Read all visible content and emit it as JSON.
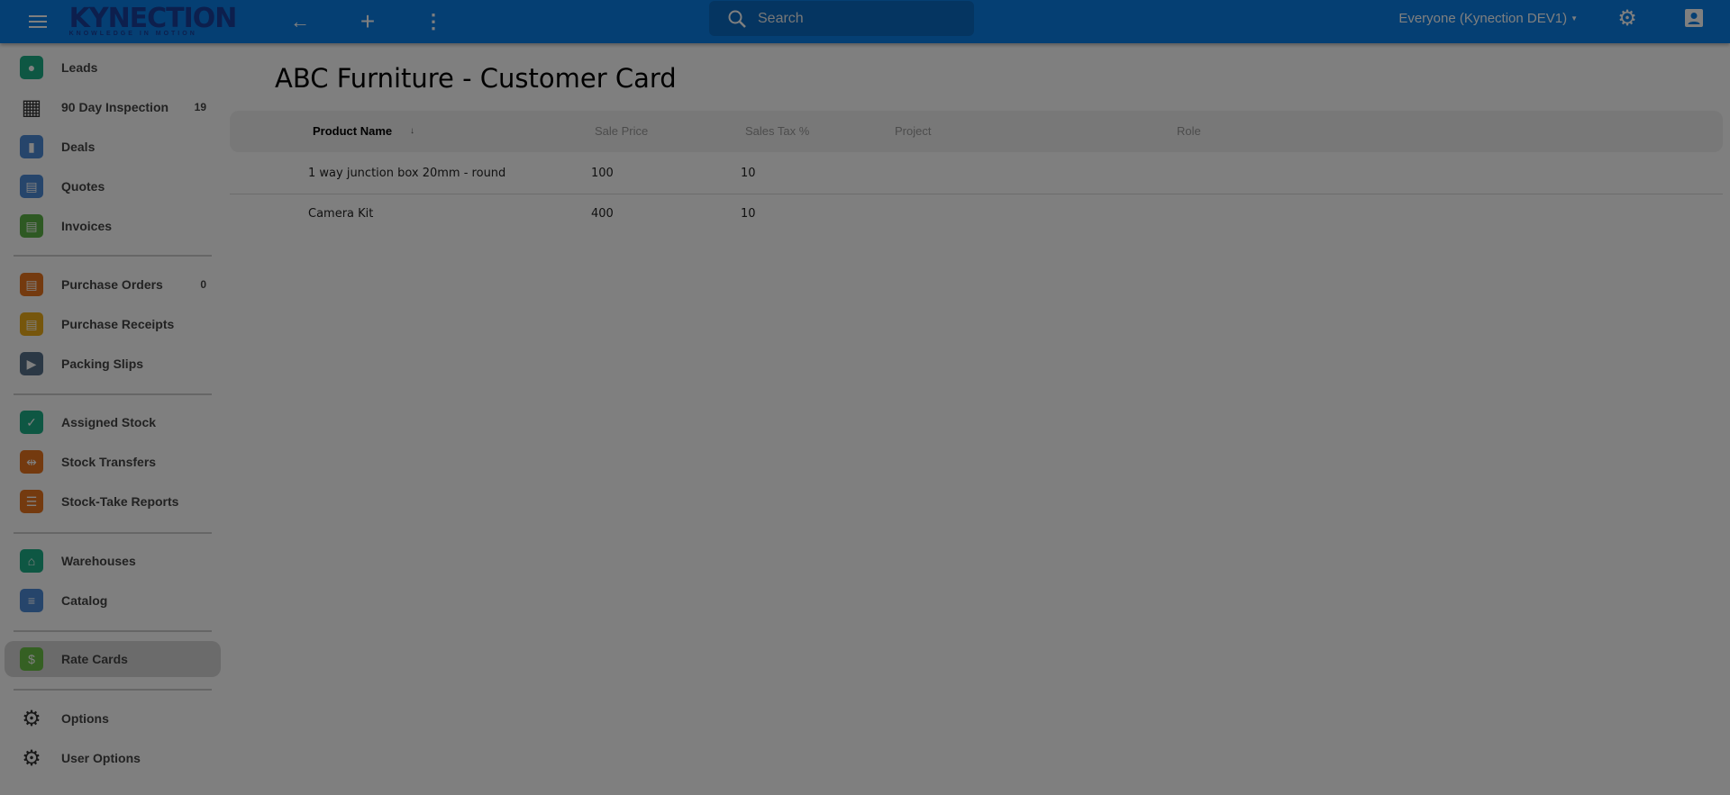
{
  "header": {
    "logo_text": "KYNECTION",
    "logo_tagline": "KNOWLEDGE IN MOTION",
    "search_placeholder": "Search",
    "org_selector": "Everyone (Kynection DEV1)"
  },
  "sidebar": {
    "items": [
      {
        "label": "Leads",
        "count": "",
        "icon": "person-icon",
        "color": "#1cae86"
      },
      {
        "label": "90 Day Inspection",
        "count": "19",
        "icon": "clipboard-icon",
        "color": ""
      },
      {
        "label": "Deals",
        "count": "",
        "icon": "bar-chart-icon",
        "color": "#4c8ad6"
      },
      {
        "label": "Quotes",
        "count": "",
        "icon": "notebook-icon",
        "color": "#4c8ad6"
      },
      {
        "label": "Invoices",
        "count": "",
        "icon": "notebook-icon",
        "color": "#5cb247"
      },
      {
        "label": "Purchase Orders",
        "count": "0",
        "icon": "notebook-icon",
        "color": "#e8741e"
      },
      {
        "label": "Purchase Receipts",
        "count": "",
        "icon": "notebook-icon",
        "color": "#ecac18"
      },
      {
        "label": "Packing Slips",
        "count": "",
        "icon": "truck-icon",
        "color": "#56708a"
      },
      {
        "label": "Assigned Stock",
        "count": "",
        "icon": "person-check-icon",
        "color": "#1cae86"
      },
      {
        "label": "Stock Transfers",
        "count": "",
        "icon": "transfer-icon",
        "color": "#e8741e"
      },
      {
        "label": "Stock-Take Reports",
        "count": "",
        "icon": "checklist-icon",
        "color": "#e8741e"
      },
      {
        "label": "Warehouses",
        "count": "",
        "icon": "warehouse-icon",
        "color": "#1cae86"
      },
      {
        "label": "Catalog",
        "count": "",
        "icon": "catalog-icon",
        "color": "#4c8ad6"
      },
      {
        "label": "Rate Cards",
        "count": "",
        "icon": "dollar-icon",
        "color": "#6bc046"
      },
      {
        "label": "Options",
        "count": "",
        "icon": "gear-icon",
        "color": ""
      },
      {
        "label": "User Options",
        "count": "",
        "icon": "gear-icon",
        "color": ""
      }
    ],
    "active": "Rate Cards"
  },
  "main": {
    "title": "ABC Furniture - Customer Card",
    "columns": [
      "Product Name",
      "Sale Price",
      "Sales Tax %",
      "Project",
      "Role"
    ],
    "sort_icon": "sort-down-icon",
    "rows": [
      [
        "1 way junction box 20mm - round",
        "100",
        "10",
        "",
        ""
      ],
      [
        "Camera Kit",
        "400",
        "10",
        "",
        ""
      ]
    ]
  }
}
